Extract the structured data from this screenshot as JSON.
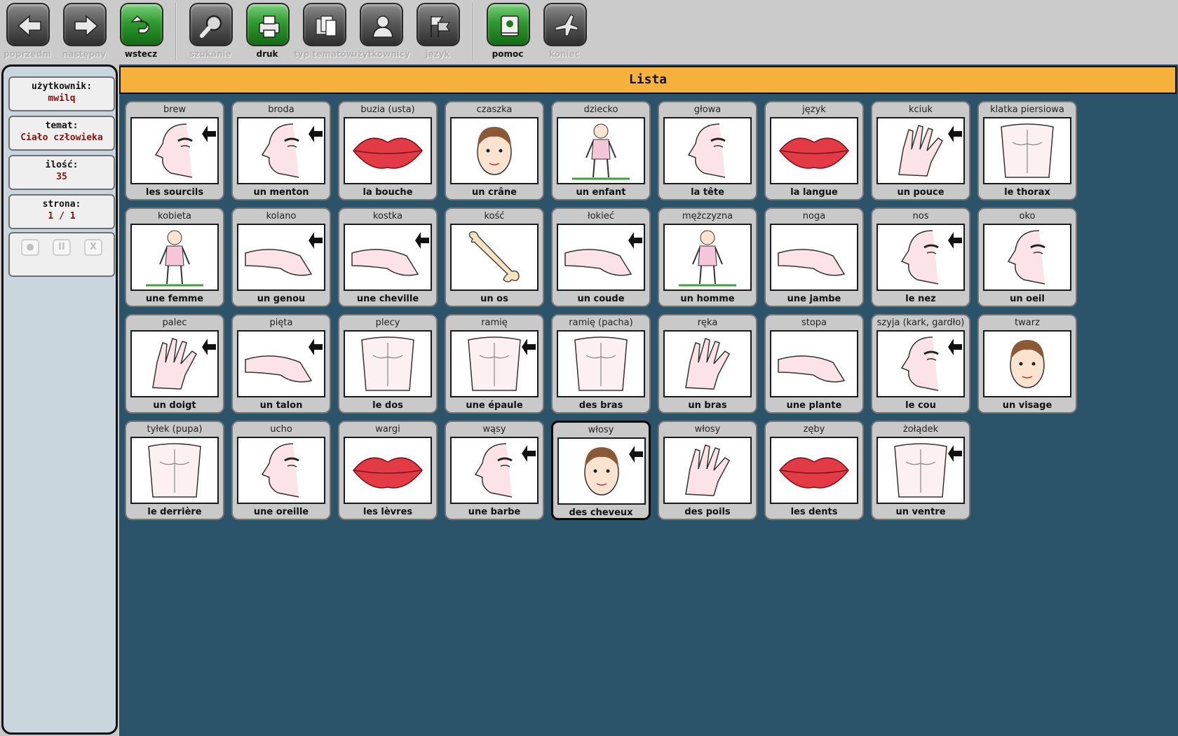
{
  "toolbar": {
    "buttons": [
      {
        "label": "poprzedni",
        "icon": "arrow-left-icon"
      },
      {
        "label": "następny",
        "icon": "arrow-right-icon"
      },
      {
        "label": "wstecz",
        "icon": "return-icon"
      },
      {
        "label": "szukanie",
        "icon": "magnifier-icon"
      },
      {
        "label": "druk",
        "icon": "print-icon"
      },
      {
        "label": "typ tematów",
        "icon": "documents-icon"
      },
      {
        "label": "użytkownicy",
        "icon": "user-icon"
      },
      {
        "label": "język",
        "icon": "flags-icon"
      },
      {
        "label": "pomoc",
        "icon": "help-book-icon"
      },
      {
        "label": "koniec",
        "icon": "plane-exit-icon"
      }
    ]
  },
  "sidebar": {
    "user_label": "użytkownik:",
    "user_value": "mwilq",
    "topic_label": "temat:",
    "topic_value": "Ciało człowieka",
    "count_label": "ilość:",
    "count_value": "35",
    "page_label": "strona:",
    "page_value": "1 / 1",
    "media": [
      {
        "name": "record-button",
        "icon": "record-icon",
        "glyph": "●"
      },
      {
        "name": "pause-button",
        "icon": "pause-icon",
        "glyph": "II"
      },
      {
        "name": "stop-button",
        "icon": "close-icon",
        "glyph": "X"
      }
    ]
  },
  "main": {
    "title": "Lista",
    "cards": [
      {
        "top": "brew",
        "bottom": "les sourcils",
        "icon": "eyebrow-picture"
      },
      {
        "top": "broda",
        "bottom": "un menton",
        "icon": "chin-picture"
      },
      {
        "top": "buzia (usta)",
        "bottom": "la bouche",
        "icon": "mouth-picture"
      },
      {
        "top": "czaszka",
        "bottom": "un crâne",
        "icon": "skull-picture"
      },
      {
        "top": "dziecko",
        "bottom": "un enfant",
        "icon": "child-picture"
      },
      {
        "top": "głowa",
        "bottom": "la tête",
        "icon": "head-picture"
      },
      {
        "top": "język",
        "bottom": "la langue",
        "icon": "tongue-picture"
      },
      {
        "top": "kciuk",
        "bottom": "un pouce",
        "icon": "thumb-picture"
      },
      {
        "top": "klatka piersiowa",
        "bottom": "le   thorax",
        "icon": "chest-picture"
      },
      {
        "top": "kobieta",
        "bottom": "une femme",
        "icon": "woman-picture"
      },
      {
        "top": "kolano",
        "bottom": "un genou",
        "icon": "knee-picture"
      },
      {
        "top": "kostka",
        "bottom": "une cheville",
        "icon": "ankle-picture"
      },
      {
        "top": "kość",
        "bottom": "un os",
        "icon": "bone-picture"
      },
      {
        "top": "łokieć",
        "bottom": "un coude",
        "icon": "elbow-picture"
      },
      {
        "top": "mężczyzna",
        "bottom": "un homme",
        "icon": "man-picture"
      },
      {
        "top": "noga",
        "bottom": "une jambe",
        "icon": "leg-picture"
      },
      {
        "top": "nos",
        "bottom": "le nez",
        "icon": "nose-picture"
      },
      {
        "top": "oko",
        "bottom": "un oeil",
        "icon": "eye-picture"
      },
      {
        "top": "palec",
        "bottom": "un doigt",
        "icon": "finger-picture"
      },
      {
        "top": "pięta",
        "bottom": "un talon",
        "icon": "heel-picture"
      },
      {
        "top": "plecy",
        "bottom": "le dos",
        "icon": "back-picture"
      },
      {
        "top": "ramię",
        "bottom": "une épaule",
        "icon": "shoulder-picture"
      },
      {
        "top": "ramię (pacha)",
        "bottom": "des bras",
        "icon": "armpit-picture"
      },
      {
        "top": "ręka",
        "bottom": "un bras",
        "icon": "hand-picture"
      },
      {
        "top": "stopa",
        "bottom": "une plante",
        "icon": "foot-picture"
      },
      {
        "top": "szyja (kark, gardło)",
        "bottom": "le cou",
        "icon": "neck-picture"
      },
      {
        "top": "twarz",
        "bottom": "un visage",
        "icon": "face-picture"
      },
      {
        "top": "tyłek (pupa)",
        "bottom": "le derrière",
        "icon": "buttocks-picture"
      },
      {
        "top": "ucho",
        "bottom": "une oreille",
        "icon": "ear-picture"
      },
      {
        "top": "wargi",
        "bottom": "les lèvres",
        "icon": "lips-picture"
      },
      {
        "top": "wąsy",
        "bottom": "une barbe",
        "icon": "beard-picture"
      },
      {
        "top": "włosy",
        "bottom": "des cheveux",
        "icon": "hair-picture"
      },
      {
        "top": "włosy",
        "bottom": "des poils",
        "icon": "body-hair-picture"
      },
      {
        "top": "zęby",
        "bottom": "les dents",
        "icon": "teeth-picture"
      },
      {
        "top": "żołądek",
        "bottom": "un ventre",
        "icon": "belly-picture"
      }
    ]
  }
}
